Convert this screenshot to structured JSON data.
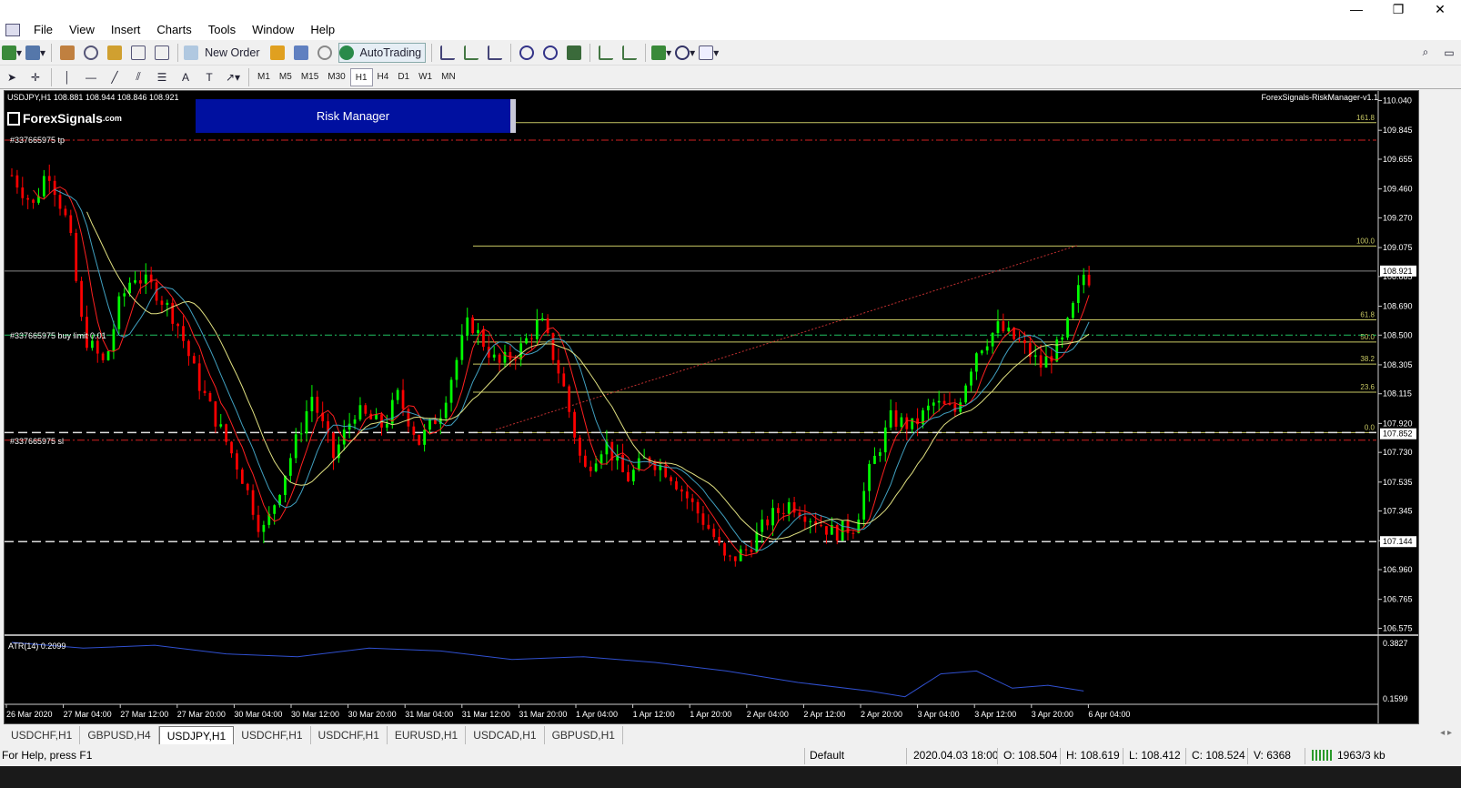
{
  "menu": {
    "items": [
      "File",
      "View",
      "Insert",
      "Charts",
      "Tools",
      "Window",
      "Help"
    ]
  },
  "toolbar": {
    "new_order_label": "New Order",
    "autotrading_label": "AutoTrading",
    "timeframes": [
      "M1",
      "M5",
      "M15",
      "M30",
      "H1",
      "H4",
      "D1",
      "W1",
      "MN"
    ],
    "active_timeframe": "H1"
  },
  "chart": {
    "header": "USDJPY,H1  108.881 108.944 108.846 108.921",
    "indicator_name": "ForexSignals-RiskManager-v1.1",
    "logo_text": "ForexSignals",
    "logo_suffix": ".com",
    "risk_manager_label": "Risk Manager",
    "order_tp_label": "#337665975 tp",
    "order_buy_label": "#337665975 buy limit 0.01",
    "order_sl_label": "#337665975 sl",
    "fib_levels": [
      {
        "label": "161.8",
        "price": 109.895
      },
      {
        "label": "100.0",
        "price": 109.085
      },
      {
        "label": "61.8",
        "price": 108.6
      },
      {
        "label": "50.0",
        "price": 108.455
      },
      {
        "label": "38.2",
        "price": 108.31
      },
      {
        "label": "23.6",
        "price": 108.125
      },
      {
        "label": "0.0",
        "price": 107.86
      }
    ],
    "tp_price": 109.78,
    "buy_price": 108.5,
    "sl_price": 107.81,
    "bid_price": "108.921",
    "sl_tag": "107.852",
    "support_tag": "107.144",
    "support_price": 107.144,
    "price_axis": [
      "110.040",
      "109.845",
      "109.655",
      "109.460",
      "109.270",
      "109.075",
      "108.885",
      "108.690",
      "108.500",
      "108.305",
      "108.115",
      "107.920",
      "107.730",
      "107.535",
      "107.345",
      "107.150",
      "106.960",
      "106.765",
      "106.575"
    ],
    "atr_label": "ATR(14) 0.2099",
    "atr_axis": [
      "0.3827",
      "0.1599"
    ],
    "time_axis": [
      "26 Mar 2020",
      "27 Mar 04:00",
      "27 Mar 12:00",
      "27 Mar 20:00",
      "30 Mar 04:00",
      "30 Mar 12:00",
      "30 Mar 20:00",
      "31 Mar 04:00",
      "31 Mar 12:00",
      "31 Mar 20:00",
      "1 Apr 04:00",
      "1 Apr 12:00",
      "1 Apr 20:00",
      "2 Apr 04:00",
      "2 Apr 12:00",
      "2 Apr 20:00",
      "3 Apr 04:00",
      "3 Apr 12:00",
      "3 Apr 20:00",
      "6 Apr 04:00"
    ],
    "colors": {
      "bull": "#00ff00",
      "bear": "#ff0000",
      "fib": "#c8c864",
      "ma_fast": "#ff2020",
      "ma_mid": "#40a0c0",
      "ma_slow": "#e0e080",
      "atr": "#3050d0"
    }
  },
  "tabs": [
    "USDCHF,H1",
    "GBPUSD,H4",
    "USDJPY,H1",
    "USDCHF,H1",
    "USDCHF,H1",
    "EURUSD,H1",
    "USDCAD,H1",
    "GBPUSD,H1"
  ],
  "active_tab": "USDJPY,H1",
  "status": {
    "help": "For Help, press F1",
    "profile": "Default",
    "datetime": "2020.04.03 18:00",
    "open": "O: 108.504",
    "high": "H: 108.619",
    "low": "L: 108.412",
    "close": "C: 108.524",
    "volume": "V: 6368",
    "traffic": "1963/3 kb"
  }
}
